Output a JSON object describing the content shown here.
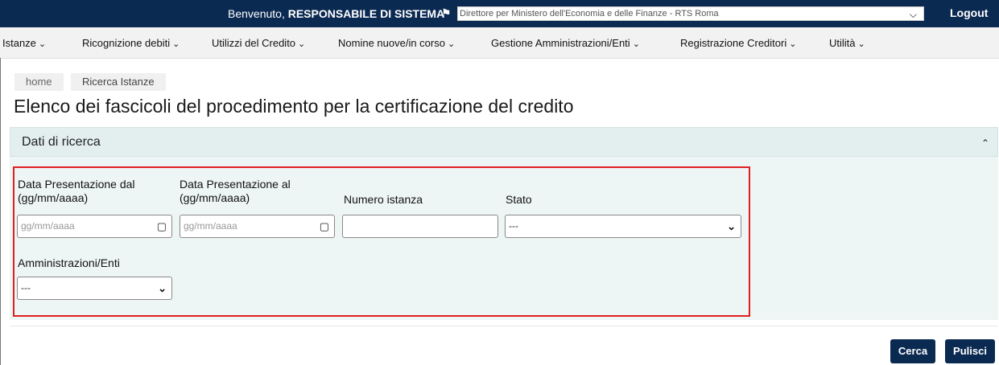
{
  "topbar": {
    "welcome_prefix": "Benvenuto,",
    "role": "RESPONSABILE DI SISTEMA",
    "organization": "Direttore per Ministero dell'Economia e delle Finanze - RTS Roma",
    "logout": "Logout"
  },
  "nav": {
    "items": [
      {
        "label": "Istanze"
      },
      {
        "label": "Ricognizione debiti"
      },
      {
        "label": "Utilizzi del Credito"
      },
      {
        "label": "Nomine nuove/in corso"
      },
      {
        "label": "Gestione Amministrazioni/Enti"
      },
      {
        "label": "Registrazione Creditori"
      },
      {
        "label": "Utilità"
      }
    ]
  },
  "breadcrumb": {
    "home": "home",
    "current": "Ricerca Istanze"
  },
  "page": {
    "title": "Elenco dei fascicoli del procedimento per la certificazione del credito"
  },
  "panel": {
    "title": "Dati di ricerca"
  },
  "form": {
    "date_from": {
      "label1": "Data Presentazione dal",
      "label2": "(gg/mm/aaaa)",
      "placeholder": "gg/mm/aaaa",
      "value": ""
    },
    "date_to": {
      "label1": "Data Presentazione al",
      "label2": "(gg/mm/aaaa)",
      "placeholder": "gg/mm/aaaa",
      "value": ""
    },
    "numero_istanza": {
      "label": "Numero istanza",
      "value": ""
    },
    "stato": {
      "label": "Stato",
      "selected": "---"
    },
    "amministrazioni": {
      "label": "Amministrazioni/Enti",
      "selected": "---"
    }
  },
  "buttons": {
    "search": "Cerca",
    "clear": "Pulisci"
  },
  "colors": {
    "primary": "#0b2a52",
    "panel": "#eef5f5",
    "highlight": "#e02020"
  },
  "icons": {
    "calendar": "calendar-icon",
    "chevron": "chevron-down-icon",
    "flag": "flag-icon"
  }
}
